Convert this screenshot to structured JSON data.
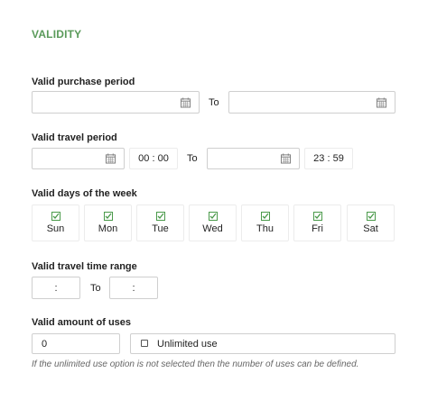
{
  "section": {
    "title": "VALIDITY"
  },
  "purchase_period": {
    "label": "Valid purchase period",
    "from_value": "",
    "to_label": "To",
    "to_value": ""
  },
  "travel_period": {
    "label": "Valid travel period",
    "from_value": "",
    "from_time": "00 : 00",
    "to_label": "To",
    "to_value": "",
    "to_time": "23 : 59"
  },
  "days": {
    "label": "Valid days of the week",
    "items": [
      {
        "name": "Sun",
        "checked": true
      },
      {
        "name": "Mon",
        "checked": true
      },
      {
        "name": "Tue",
        "checked": true
      },
      {
        "name": "Wed",
        "checked": true
      },
      {
        "name": "Thu",
        "checked": true
      },
      {
        "name": "Fri",
        "checked": true
      },
      {
        "name": "Sat",
        "checked": true
      }
    ]
  },
  "time_range": {
    "label": "Valid travel time range",
    "from_value": ":",
    "to_label": "To",
    "to_value": ":"
  },
  "uses": {
    "label": "Valid amount of uses",
    "value": "0",
    "unlimited_label": "Unlimited use",
    "unlimited_checked": false,
    "hint": "If the unlimited use option is not selected then the number of uses can be defined."
  },
  "icons": {
    "calendar": "calendar-icon",
    "check": "check-icon"
  },
  "colors": {
    "section_title": "#5a9a5a",
    "check": "#4a9a4a"
  }
}
